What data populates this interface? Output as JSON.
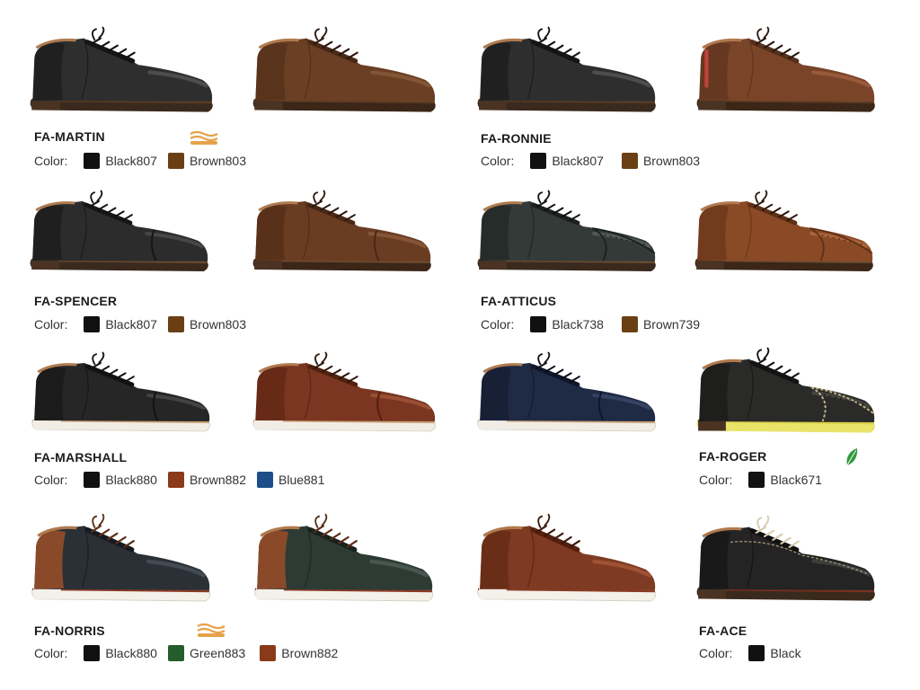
{
  "color_label": "Color:",
  "icons": {
    "sole": "cushion-icon",
    "leaf": "vegan-leaf-icon"
  },
  "models": [
    {
      "name": "FA-MARTIN",
      "colors": [
        {
          "code": "Black807",
          "hex": "#111111"
        },
        {
          "code": "Brown803",
          "hex": "#6b3f14"
        }
      ],
      "badge": "cushion-icon"
    },
    {
      "name": "FA-RONNIE",
      "colors": [
        {
          "code": "Black807",
          "hex": "#111111"
        },
        {
          "code": "Brown803",
          "hex": "#6b3f14"
        }
      ]
    },
    {
      "name": "FA-SPENCER",
      "colors": [
        {
          "code": "Black807",
          "hex": "#111111"
        },
        {
          "code": "Brown803",
          "hex": "#6b3f14"
        }
      ]
    },
    {
      "name": "FA-ATTICUS",
      "colors": [
        {
          "code": "Black738",
          "hex": "#111111"
        },
        {
          "code": "Brown739",
          "hex": "#6b3f14"
        }
      ]
    },
    {
      "name": "FA-MARSHALL",
      "colors": [
        {
          "code": "Black880",
          "hex": "#111111"
        },
        {
          "code": "Brown882",
          "hex": "#8a3a18"
        },
        {
          "code": "Blue881",
          "hex": "#1d4e8a"
        }
      ]
    },
    {
      "name": "FA-ROGER",
      "colors": [
        {
          "code": "Black671",
          "hex": "#111111"
        }
      ],
      "badge": "vegan-leaf-icon"
    },
    {
      "name": "FA-NORRIS",
      "colors": [
        {
          "code": "Black880",
          "hex": "#111111"
        },
        {
          "code": "Green883",
          "hex": "#245c2c"
        },
        {
          "code": "Brown882",
          "hex": "#8a3a18"
        }
      ],
      "badge": "cushion-icon"
    },
    {
      "name": "FA-ACE",
      "colors": [
        {
          "code": "Black",
          "hex": "#111111"
        }
      ]
    }
  ]
}
